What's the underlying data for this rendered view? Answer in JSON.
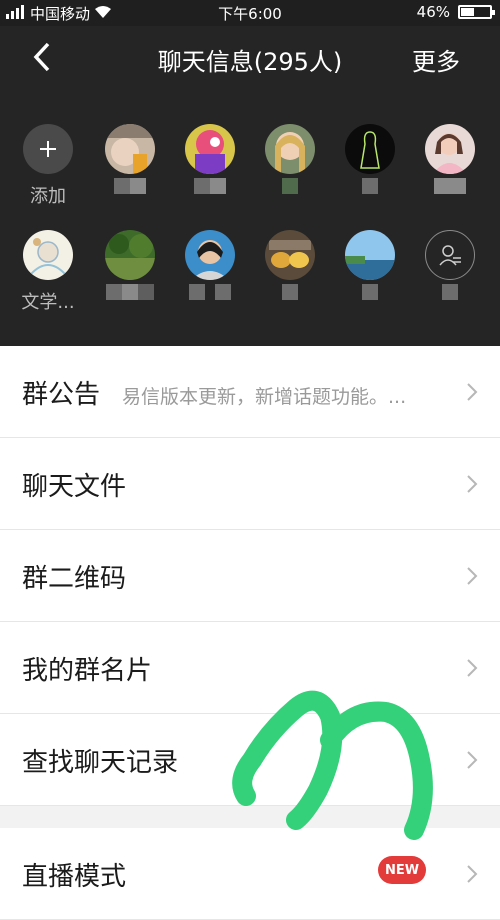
{
  "status_bar": {
    "carrier": "中国移动",
    "time": "下午6:00",
    "battery": "46%",
    "battery_level": 0.46
  },
  "header": {
    "title": "聊天信息(295人)",
    "more": "更多"
  },
  "members": {
    "add_label": "添加",
    "member_name": "文学..."
  },
  "settings": {
    "announcement_label": "群公告",
    "announcement_value": "易信版本更新，新增话题功能。...",
    "chat_files": "聊天文件",
    "qr_code": "群二维码",
    "my_card": "我的群名片",
    "search_history": "查找聊天记录",
    "live_mode": "直播模式",
    "new_badge": "NEW"
  },
  "colors": {
    "dark_bg": "#252525",
    "scribble": "#35d07a",
    "badge": "#e33a3a"
  }
}
